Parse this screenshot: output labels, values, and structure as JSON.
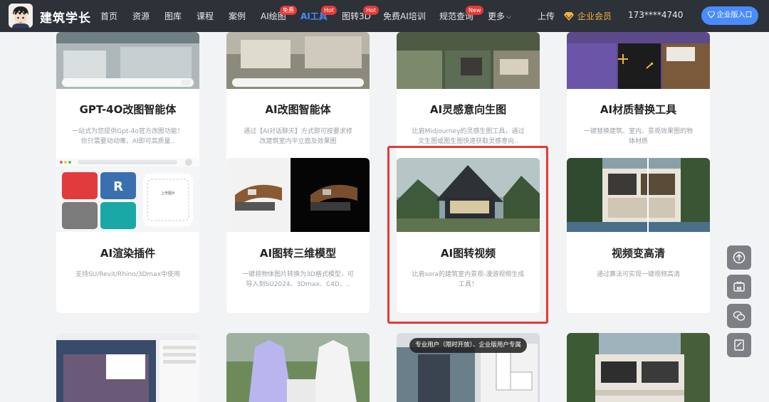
{
  "brand": {
    "name": "建筑学长"
  },
  "nav": {
    "items": [
      {
        "label": "首页"
      },
      {
        "label": "资源"
      },
      {
        "label": "图库"
      },
      {
        "label": "课程"
      },
      {
        "label": "案例"
      },
      {
        "label": "AI绘图",
        "badge": "免费"
      },
      {
        "label": "AI工具",
        "badge": "Hot",
        "active": true
      },
      {
        "label": "图转3D",
        "badge": "Hot"
      },
      {
        "label": "免费AI培训"
      },
      {
        "label": "规范查询",
        "badge": "New"
      },
      {
        "label": "更多"
      }
    ],
    "upload": "上传",
    "vip": "企业会员",
    "phone": "173****4740",
    "enterprise_button": "企业版入口"
  },
  "cards_row1": [
    {
      "title": "GPT-4O改图智能体",
      "desc": "一站式为您提供Gpt-4o官方改图功能！你只需要动动嘴，AI即可高质量.."
    },
    {
      "title": "AI改图智能体",
      "desc": "通过【AI对话聊天】方式即可按要求修改建筑室内平立面及效果图"
    },
    {
      "title": "AI灵感意向生图",
      "desc": "比肩Midjourney的灵感生图工具，通过文生图或图生图快速获取灵感意向.."
    },
    {
      "title": "AI材质替换工具",
      "desc": "一键替换建筑、室内、景观效果图的物体材质"
    }
  ],
  "cards_row2": [
    {
      "title": "AI渲染插件",
      "desc": "支持SU/Revit/Rhino/3Dmax中使用"
    },
    {
      "title": "AI图转三维模型",
      "desc": "一键将物体图片转换为3D格式模型，可导入到SU2024、3Dmax、C4D、.."
    },
    {
      "title": "AI图转视频",
      "desc": "比肩sora的建筑室内景观-漫游视频生成工具！"
    },
    {
      "title": "视频变高清",
      "desc": "通过算法可实现一键视频高清"
    }
  ],
  "thumb_texts": {
    "upload_card": "上传图片",
    "pill": "专业用户（限时开放）、企业版用户专属"
  },
  "float_buttons": [
    "upload-arrow-icon",
    "video-icon",
    "wechat-icon",
    "edit-icon"
  ]
}
